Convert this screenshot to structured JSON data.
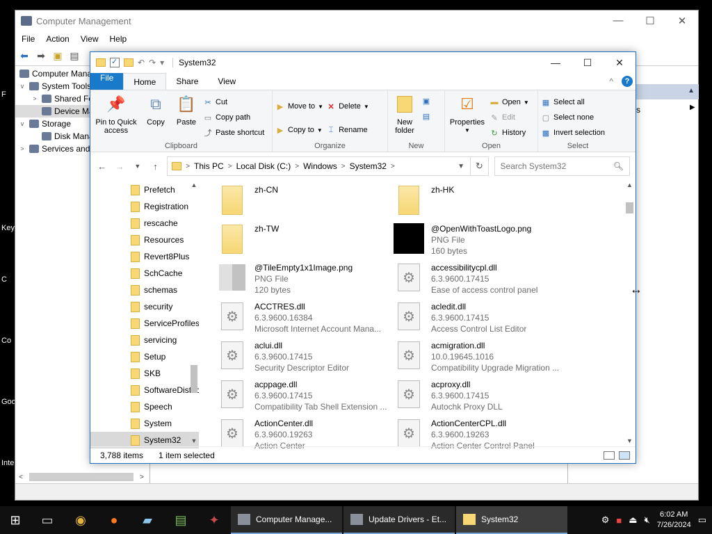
{
  "desktop": {
    "edge_labels": [
      "F",
      "Key",
      "C",
      "Co",
      "Goo",
      "Inte"
    ]
  },
  "computer_management": {
    "title": "Computer Management",
    "menu": [
      "File",
      "Action",
      "View",
      "Help"
    ],
    "tree": [
      {
        "label": "Computer Management",
        "indent": 0,
        "expander": ""
      },
      {
        "label": "System Tools",
        "indent": 1,
        "expander": "v"
      },
      {
        "label": "Shared Folders",
        "indent": 2,
        "expander": ">"
      },
      {
        "label": "Device Manager",
        "indent": 2,
        "expander": "",
        "selected": true
      },
      {
        "label": "Storage",
        "indent": 1,
        "expander": "v"
      },
      {
        "label": "Disk Management",
        "indent": 2,
        "expander": ""
      },
      {
        "label": "Services and Applications",
        "indent": 1,
        "expander": ">"
      }
    ],
    "actions_text": "s"
  },
  "explorer": {
    "title": "System32",
    "ribbon_tabs": [
      "File",
      "Home",
      "Share",
      "View"
    ],
    "active_tab": "Home",
    "help_label": "?",
    "clipboard": {
      "group_label": "Clipboard",
      "pin_label": "Pin to Quick access",
      "copy_label": "Copy",
      "paste_label": "Paste",
      "cut_label": "Cut",
      "copy_path_label": "Copy path",
      "paste_shortcut_label": "Paste shortcut"
    },
    "organize": {
      "group_label": "Organize",
      "move_to_label": "Move to",
      "copy_to_label": "Copy to",
      "delete_label": "Delete",
      "rename_label": "Rename"
    },
    "new": {
      "group_label": "New",
      "new_folder_label": "New folder"
    },
    "open": {
      "group_label": "Open",
      "properties_label": "Properties",
      "open_label": "Open",
      "edit_label": "Edit",
      "history_label": "History"
    },
    "select": {
      "group_label": "Select",
      "select_all_label": "Select all",
      "select_none_label": "Select none",
      "invert_label": "Invert selection"
    },
    "address": {
      "crumbs": [
        "This PC",
        "Local Disk (C:)",
        "Windows",
        "System32"
      ],
      "search_placeholder": "Search System32"
    },
    "nav_items": [
      {
        "label": "Prefetch"
      },
      {
        "label": "Registration"
      },
      {
        "label": "rescache"
      },
      {
        "label": "Resources"
      },
      {
        "label": "Revert8Plus"
      },
      {
        "label": "SchCache"
      },
      {
        "label": "schemas"
      },
      {
        "label": "security"
      },
      {
        "label": "ServiceProfiles"
      },
      {
        "label": "servicing"
      },
      {
        "label": "Setup"
      },
      {
        "label": "SKB"
      },
      {
        "label": "SoftwareDistribution"
      },
      {
        "label": "Speech"
      },
      {
        "label": "System"
      },
      {
        "label": "System32",
        "selected": true
      }
    ],
    "files": [
      {
        "name": "zh-CN",
        "icon": "folder",
        "line2": "",
        "line3": ""
      },
      {
        "name": "zh-HK",
        "icon": "folder",
        "line2": "",
        "line3": ""
      },
      {
        "name": "zh-TW",
        "icon": "folder",
        "line2": "",
        "line3": ""
      },
      {
        "name": "@OpenWithToastLogo.png",
        "icon": "black",
        "line2": "PNG File",
        "line3": "160 bytes"
      },
      {
        "name": "@TileEmpty1x1Image.png",
        "icon": "thumb",
        "line2": "PNG File",
        "line3": "120 bytes"
      },
      {
        "name": "accessibilitycpl.dll",
        "icon": "dll",
        "line2": "6.3.9600.17415",
        "line3": "Ease of access  control panel"
      },
      {
        "name": "ACCTRES.dll",
        "icon": "dll",
        "line2": "6.3.9600.16384",
        "line3": "Microsoft Internet Account Mana..."
      },
      {
        "name": "acledit.dll",
        "icon": "dll",
        "line2": "6.3.9600.17415",
        "line3": "Access Control List Editor"
      },
      {
        "name": "aclui.dll",
        "icon": "dll",
        "line2": "6.3.9600.17415",
        "line3": "Security Descriptor Editor"
      },
      {
        "name": "acmigration.dll",
        "icon": "dll",
        "line2": "10.0.19645.1016",
        "line3": "Compatibility Upgrade Migration ..."
      },
      {
        "name": "acppage.dll",
        "icon": "dll",
        "line2": "6.3.9600.17415",
        "line3": "Compatibility Tab Shell Extension ..."
      },
      {
        "name": "acproxy.dll",
        "icon": "dll",
        "line2": "6.3.9600.17415",
        "line3": "Autochk Proxy DLL"
      },
      {
        "name": "ActionCenter.dll",
        "icon": "dll",
        "line2": "6.3.9600.19263",
        "line3": "Action Center"
      },
      {
        "name": "ActionCenterCPL.dll",
        "icon": "dll",
        "line2": "6.3.9600.19263",
        "line3": "Action Center Control Panel"
      }
    ],
    "status": {
      "item_count": "3,788 items",
      "selection": "1 item selected"
    }
  },
  "taskbar": {
    "tasks": [
      {
        "label": "Computer Manage...",
        "icon": "gray"
      },
      {
        "label": "Update Drivers - Et...",
        "icon": "gray"
      },
      {
        "label": "System32",
        "icon": "folder",
        "active": true
      }
    ],
    "time": "6:02 AM",
    "date": "7/26/2024"
  }
}
